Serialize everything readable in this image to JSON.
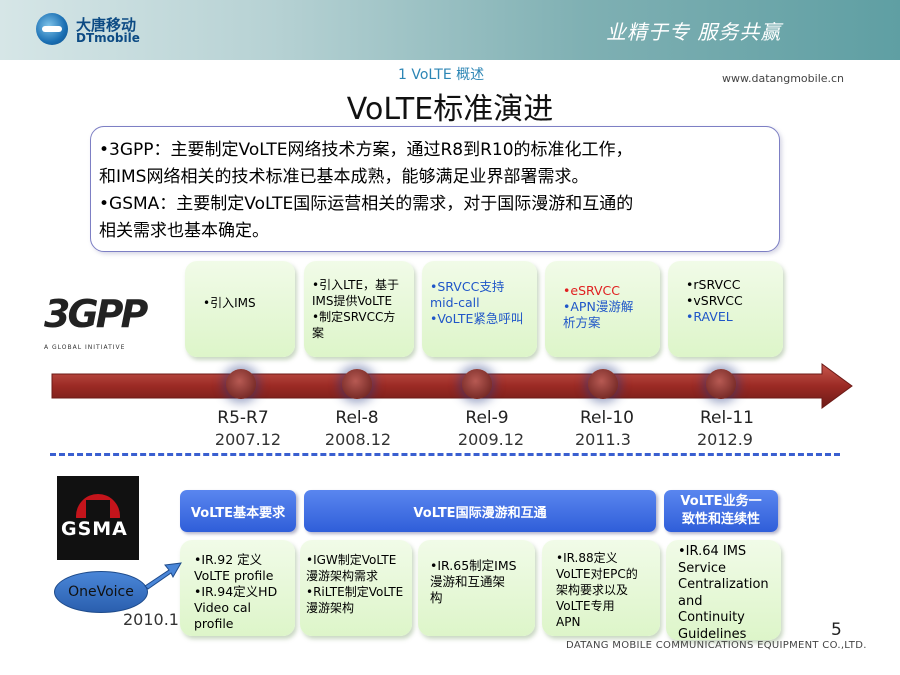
{
  "header": {
    "logo_cn": "大唐移动",
    "logo_en": "DTmobile",
    "slogan": "业精于专 服务共赢"
  },
  "section_label": "1 VoLTE 概述",
  "url": "www.datangmobile.cn",
  "title": "VoLTE标准演进",
  "summary": {
    "line1": "•3GPP：主要制定VoLTE网络技术方案，通过R8到R10的标准化工作，",
    "line2": "和IMS网络相关的技术标准已基本成熟，能够满足业界部署需求。",
    "line3": "•GSMA：主要制定VoLTE国际运营相关的需求，对于国际漫游和互通的",
    "line4": "相关需求也基本确定。"
  },
  "logo_3gpp": {
    "mark": "3GPP",
    "tagline": "A GLOBAL INITIATIVE"
  },
  "logo_gsma": {
    "mark": "GSMA"
  },
  "timeline_3gpp": [
    {
      "release": "R5-R7",
      "date": "2007.12",
      "items": [
        "•引入IMS"
      ]
    },
    {
      "release": "Rel-8",
      "date": "2008.12",
      "items": [
        "•引入LTE，基于",
        "IMS提供VoLTE",
        "•制定SRVCC方",
        "案"
      ]
    },
    {
      "release": "Rel-9",
      "date": "2009.12",
      "items": [
        "•SRVCC支持",
        "mid-call",
        "•VoLTE紧急呼叫"
      ]
    },
    {
      "release": "Rel-10",
      "date": "2011.3",
      "items": [
        "•eSRVCC",
        "•APN漫游解",
        "析方案"
      ]
    },
    {
      "release": "Rel-11",
      "date": "2012.9",
      "items": [
        "•rSRVCC",
        "•vSRVCC",
        "•RAVEL"
      ]
    }
  ],
  "gsma_categories": [
    {
      "label": "VoLTE基本要求"
    },
    {
      "label": "VoLTE国际漫游和互通"
    },
    {
      "label": "VoLTE业务一致性和连续性"
    }
  ],
  "gsma_docs": [
    {
      "items": [
        "•IR.92 定义",
        "VoLTE profile",
        "•IR.94定义HD",
        "Video cal",
        "profile"
      ]
    },
    {
      "items": [
        "•IGW制定VoLTE",
        "漫游架构需求",
        "•RiLTE制定VoLTE",
        "漫游架构"
      ]
    },
    {
      "items": [
        "•IR.65制定IMS",
        "漫游和互通架",
        "构"
      ]
    },
    {
      "items": [
        "•IR.88定义",
        "VoLTE对EPC的",
        "架构要求以及",
        "VoLTE专用",
        "APN"
      ]
    },
    {
      "items": [
        "•IR.64 IMS",
        "Service",
        "Centralization",
        "and",
        "Continuity",
        "Guidelines"
      ]
    }
  ],
  "onevoice": {
    "label": "OneVoice",
    "year": "2010.1"
  },
  "footer": "DATANG MOBILE COMMUNICATIONS EQUIPMENT CO.,LTD.",
  "page_number": "5",
  "colors": {
    "accent_blue": "#2f5ed9",
    "timeline_red": "#9b2a24",
    "box_green": "#ddf5c9",
    "header_teal": "#5f9fa3"
  }
}
